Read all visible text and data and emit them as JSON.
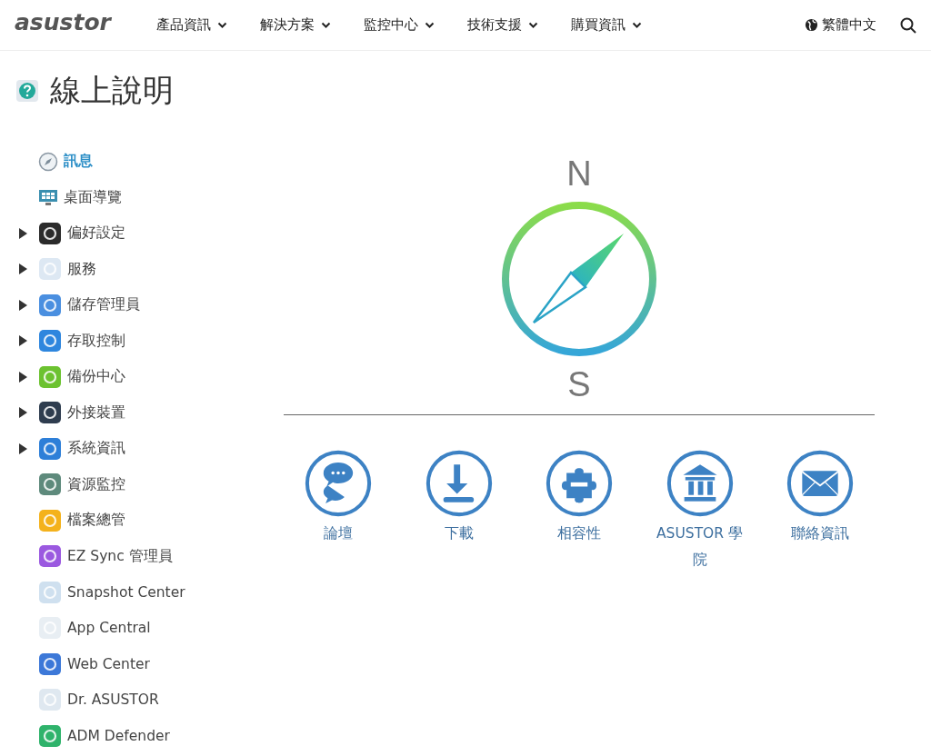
{
  "header": {
    "logo": "asustor",
    "nav": [
      {
        "label": "產品資訊"
      },
      {
        "label": "解決方案"
      },
      {
        "label": "監控中心"
      },
      {
        "label": "技術支援"
      },
      {
        "label": "購買資訊"
      }
    ],
    "language": "繁體中文"
  },
  "page_title": "線上說明",
  "sidebar": {
    "items": [
      {
        "label": "訊息",
        "kind": "page",
        "selected": true
      },
      {
        "label": "桌面導覽",
        "kind": "page",
        "selected": false
      },
      {
        "label": "偏好設定",
        "kind": "group",
        "selected": false
      },
      {
        "label": "服務",
        "kind": "group",
        "selected": false
      },
      {
        "label": "儲存管理員",
        "kind": "group",
        "selected": false
      },
      {
        "label": "存取控制",
        "kind": "group",
        "selected": false
      },
      {
        "label": "備份中心",
        "kind": "group",
        "selected": false
      },
      {
        "label": "外接裝置",
        "kind": "group",
        "selected": false
      },
      {
        "label": "系統資訊",
        "kind": "group",
        "selected": false
      },
      {
        "label": "資源監控",
        "kind": "page",
        "selected": false
      },
      {
        "label": "檔案總管",
        "kind": "page",
        "selected": false
      },
      {
        "label": "EZ Sync 管理員",
        "kind": "page",
        "selected": false
      },
      {
        "label": "Snapshot Center",
        "kind": "page",
        "selected": false
      },
      {
        "label": "App Central",
        "kind": "page",
        "selected": false
      },
      {
        "label": "Web Center",
        "kind": "page",
        "selected": false
      },
      {
        "label": "Dr. ASUSTOR",
        "kind": "page",
        "selected": false
      },
      {
        "label": "ADM Defender",
        "kind": "page",
        "selected": false
      }
    ]
  },
  "compass": {
    "north": "N",
    "south": "S"
  },
  "links": [
    {
      "label": "論壇",
      "kind": "forum"
    },
    {
      "label": "下載",
      "kind": "download"
    },
    {
      "label": "相容性",
      "kind": "compatibility"
    },
    {
      "label": "ASUSTOR 學院",
      "kind": "academy"
    },
    {
      "label": "聯絡資訊",
      "kind": "contact"
    }
  ]
}
